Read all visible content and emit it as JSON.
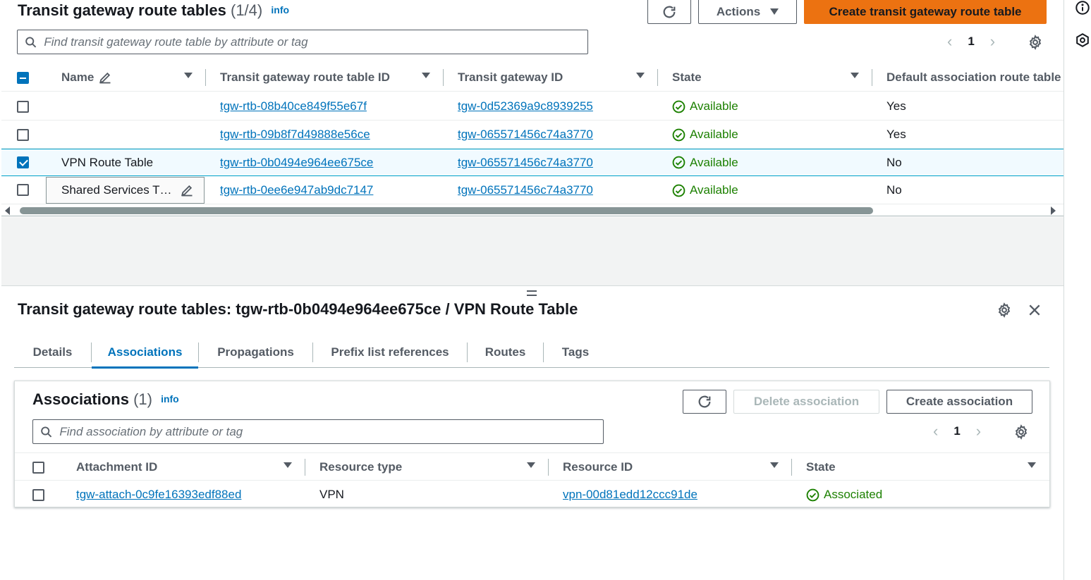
{
  "top": {
    "title": "Transit gateway route tables",
    "count": "(1/4)",
    "info": "info",
    "actions_label": "Actions",
    "create_label": "Create transit gateway route table",
    "search_placeholder": "Find transit gateway route table by attribute or tag",
    "page": "1",
    "columns": [
      "Name",
      "Transit gateway route table ID",
      "Transit gateway ID",
      "State",
      "Default association route table"
    ],
    "rows": [
      {
        "name": "",
        "rtb_id": "tgw-rtb-08b40ce849f55e67f",
        "tgw_id": "tgw-0d52369a9c8939255",
        "state": "Available",
        "default_assoc": "Yes",
        "selected": false
      },
      {
        "name": "",
        "rtb_id": "tgw-rtb-09b8f7d49888e56ce",
        "tgw_id": "tgw-065571456c74a3770",
        "state": "Available",
        "default_assoc": "Yes",
        "selected": false
      },
      {
        "name": "VPN Route Table",
        "rtb_id": "tgw-rtb-0b0494e964ee675ce",
        "tgw_id": "tgw-065571456c74a3770",
        "state": "Available",
        "default_assoc": "No",
        "selected": true
      },
      {
        "name": "Shared Services T…",
        "rtb_id": "tgw-rtb-0ee6e947ab9dc7147",
        "tgw_id": "tgw-065571456c74a3770",
        "state": "Available",
        "default_assoc": "No",
        "selected": false
      }
    ]
  },
  "detail": {
    "title": "Transit gateway route tables: tgw-rtb-0b0494e964ee675ce / VPN Route Table",
    "tabs": [
      "Details",
      "Associations",
      "Propagations",
      "Prefix list references",
      "Routes",
      "Tags"
    ],
    "active_tab": "Associations"
  },
  "associations": {
    "title": "Associations",
    "count": "(1)",
    "info": "info",
    "delete_label": "Delete association",
    "create_label": "Create association",
    "search_placeholder": "Find association by attribute or tag",
    "page": "1",
    "columns": [
      "Attachment ID",
      "Resource type",
      "Resource ID",
      "State"
    ],
    "rows": [
      {
        "attachment_id": "tgw-attach-0c9fe16393edf88ed",
        "resource_type": "VPN",
        "resource_id": "vpn-00d81edd12ccc91de",
        "state": "Associated"
      }
    ]
  },
  "colors": {
    "primary": "#ec7211",
    "link": "#0073bb",
    "success": "#1d8102"
  }
}
